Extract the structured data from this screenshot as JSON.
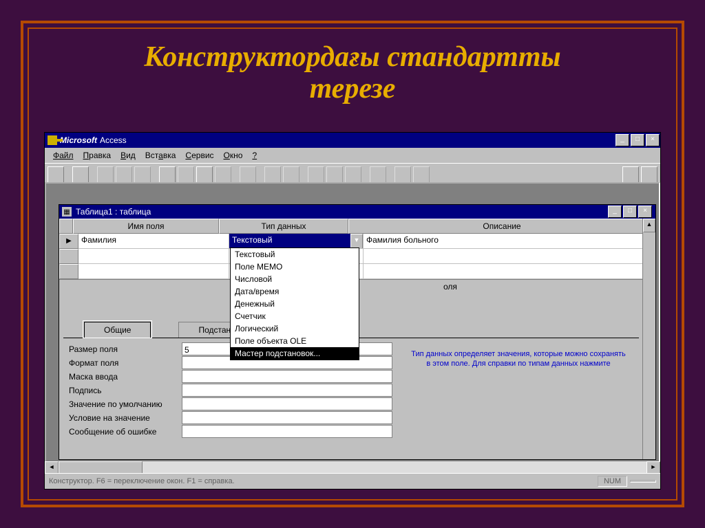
{
  "slide": {
    "title_line1": "Конструктордағы стандартты",
    "title_line2": "терезе"
  },
  "app": {
    "title_brand": "Microsoft",
    "title_app": "Access",
    "menu": [
      "Файл",
      "Правка",
      "Вид",
      "Вставка",
      "Сервис",
      "Окно",
      "?"
    ]
  },
  "child": {
    "title": "Таблица1 : таблица",
    "headers": {
      "name": "Имя поля",
      "type": "Тип данных",
      "desc": "Описание"
    },
    "rows": [
      {
        "sel": "▶",
        "name": "Фамилия",
        "type": "Текстовый",
        "desc": "Фамилия больного"
      },
      {
        "sel": "",
        "name": "",
        "type": "",
        "desc": ""
      },
      {
        "sel": "",
        "name": "",
        "type": "",
        "desc": ""
      }
    ],
    "mid_label": "оля"
  },
  "dropdown": {
    "current": "Текстовый",
    "options": [
      "Текстовый",
      "Поле МЕМО",
      "Числовой",
      "Дата/время",
      "Денежный",
      "Счетчик",
      "Логический",
      "Поле объекта OLE",
      "Мастер подстановок..."
    ],
    "highlight_index": 8
  },
  "tabs": {
    "t1": "Общие",
    "t2": "Подстановк"
  },
  "props": {
    "items": [
      {
        "label": "Размер поля",
        "val": "5"
      },
      {
        "label": "Формат поля",
        "val": ""
      },
      {
        "label": "Маска ввода",
        "val": ""
      },
      {
        "label": "Подпись",
        "val": ""
      },
      {
        "label": "Значение по умолчанию",
        "val": ""
      },
      {
        "label": "Условие на значение",
        "val": ""
      },
      {
        "label": "Сообщение об ошибке",
        "val": ""
      }
    ],
    "help": "Тип данных определяет значения, которые можно сохранять в этом поле.  Для справки по типам данных нажмите"
  },
  "status": {
    "text": "Конструктор.  F6 = переключение окон.  F1 = справка.",
    "indicator": "NUM"
  }
}
